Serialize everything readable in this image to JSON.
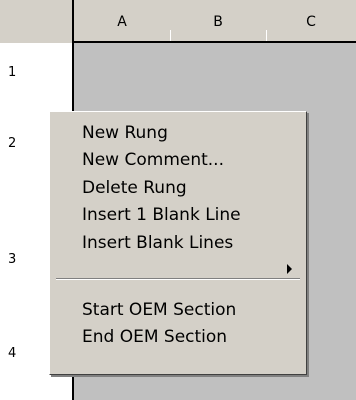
{
  "columns": [
    "A",
    "B",
    "C"
  ],
  "rows": [
    "1",
    "2",
    "3",
    "4"
  ],
  "context_menu": {
    "items": [
      {
        "label": "New Rung"
      },
      {
        "label": "New Comment..."
      },
      {
        "label": "Delete Rung"
      },
      {
        "label": "Insert 1 Blank Line"
      },
      {
        "label": "Insert Blank Lines",
        "has_submenu": true
      },
      {
        "label": "Start OEM Section"
      },
      {
        "label": "End OEM Section"
      }
    ]
  },
  "icons": {
    "submenu_arrow": "triangle-right-icon"
  },
  "colors": {
    "menu_background": "#d4d0c8",
    "grid_background": "#c0c0c0"
  }
}
